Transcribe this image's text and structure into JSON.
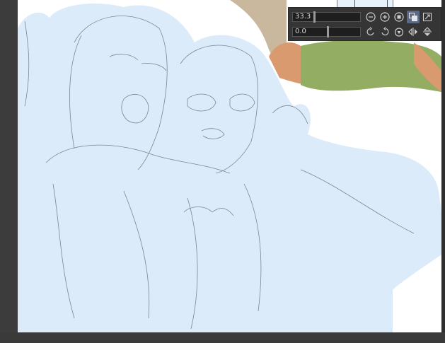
{
  "navigator": {
    "zoom_value": "33.3",
    "rotation_value": "0.0",
    "zoom_fraction": 0.3,
    "rotation_fraction": 0.5
  },
  "icons": {
    "zoom_out": "zoom-out-icon",
    "zoom_in": "zoom-in-icon",
    "fit": "fit-icon",
    "fit_window": "fit-window-icon",
    "fill_window": "fill-window-icon",
    "rotate_left": "rotate-left-icon",
    "rotate_right": "rotate-right-icon",
    "reset_rotation": "reset-rotation-icon",
    "flip_horizontal": "flip-horizontal-icon",
    "flip_vertical": "flip-vertical-icon"
  },
  "colors": {
    "active_button": "#5a6a86",
    "sketch_fill": "#dcebf9",
    "sketch_line": "#5a6470"
  }
}
